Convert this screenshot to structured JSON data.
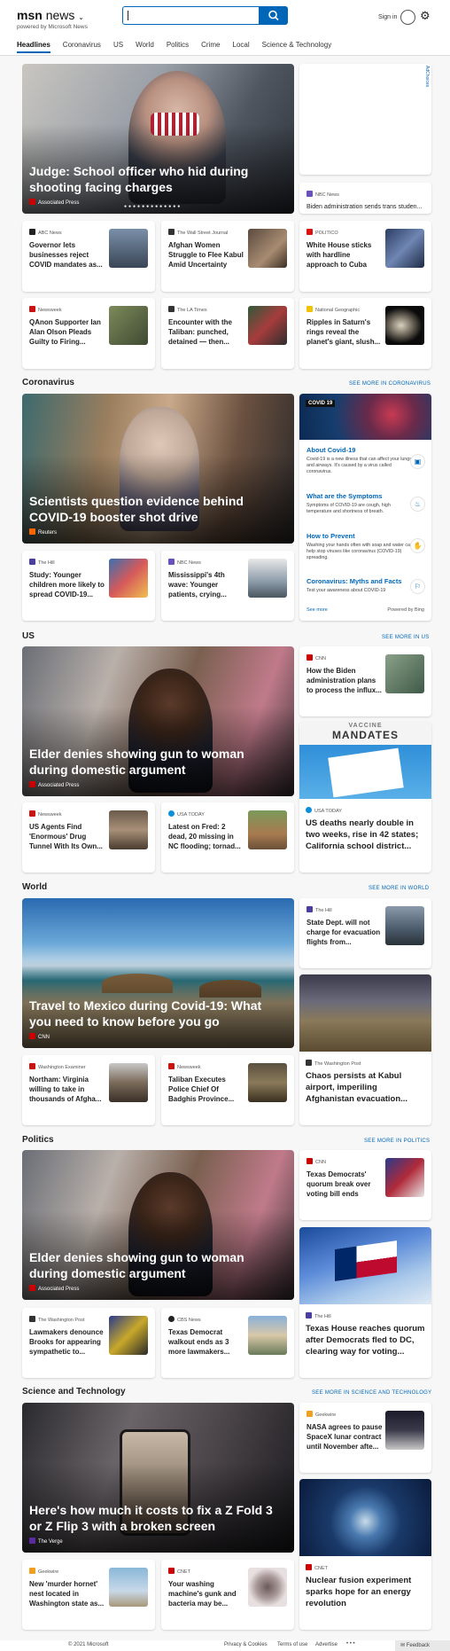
{
  "header": {
    "logo": "msn",
    "logo_sub": "news",
    "powered": "powered by Microsoft News",
    "signin": "Sign in",
    "search_value": ""
  },
  "nav": [
    "Headlines",
    "Coronavirus",
    "US",
    "World",
    "Politics",
    "Crime",
    "Local",
    "Science & Technology"
  ],
  "top": {
    "hero": {
      "title": "Judge: School officer who hid during shooting facing charges",
      "source": "Associated Press"
    },
    "side1": {
      "source": "NBC News",
      "title": "Biden administration sends trans studen..."
    },
    "row1": [
      {
        "source": "ABC News",
        "title": "Governor lets businesses reject COVID mandates as..."
      },
      {
        "source": "The Wall Street Journal",
        "title": "Afghan Women Struggle to Flee Kabul Amid Uncertainty"
      },
      {
        "source": "POLITICO",
        "title": "White House sticks with hardline approach to Cuba"
      }
    ],
    "row2": [
      {
        "source": "Newsweek",
        "title": "QAnon Supporter Ian Alan Olson Pleads Guilty to Firing..."
      },
      {
        "source": "The LA Times",
        "title": "Encounter with the Taliban: punched, detained — then..."
      },
      {
        "source": "National Geographic",
        "title": "Ripples in Saturn's rings reveal the planet's giant, slush..."
      }
    ]
  },
  "coronavirus": {
    "heading": "Coronavirus",
    "more": "SEE MORE IN CORONAVIRUS",
    "hero": {
      "title": "Scientists question evidence behind COVID-19 booster shot drive",
      "source": "Reuters"
    },
    "panel": {
      "banner": "COVID 19",
      "items": [
        {
          "title": "About Covid-19",
          "desc": "Covid-19 is a new illness that can affect your lungs and airways. It's caused by a virus called coronavirus."
        },
        {
          "title": "What are the Symptoms",
          "desc": "Symptoms of COVID-19 are cough, high temperature and shortness of breath."
        },
        {
          "title": "How to Prevent",
          "desc": "Washing your hands often with soap and water can help stop viruses like coronavirus (COVID-19) spreading."
        },
        {
          "title": "Coronavirus: Myths and Facts",
          "desc": "Test your awareness about COVID-19"
        }
      ],
      "see_more": "See more",
      "powered": "Powered by Bing"
    },
    "row": [
      {
        "source": "The Hill",
        "title": "Study: Younger children more likely to spread COVID-19..."
      },
      {
        "source": "NBC News",
        "title": "Mississippi's 4th wave: Younger patients, crying..."
      }
    ]
  },
  "us": {
    "heading": "US",
    "more": "SEE MORE IN US",
    "hero": {
      "title": "Elder denies showing gun to woman during domestic argument",
      "source": "Associated Press"
    },
    "side1": {
      "source": "CNN",
      "title": "How the Biden administration plans to process the influx..."
    },
    "side2": {
      "banner": "MANDATES",
      "banner_top": "VACCINE",
      "source": "USA TODAY",
      "title": "US deaths nearly double in two weeks, rise in 42 states; California school district..."
    },
    "row": [
      {
        "source": "Newsweek",
        "title": "US Agents Find 'Enormous' Drug Tunnel With Its Own..."
      },
      {
        "source": "USA TODAY",
        "title": "Latest on Fred: 2 dead, 20 missing in NC flooding; tornad..."
      }
    ]
  },
  "world": {
    "heading": "World",
    "more": "SEE MORE IN WORLD",
    "hero": {
      "title": "Travel to Mexico during Covid-19: What you need to know before you go",
      "source": "CNN"
    },
    "side1": {
      "source": "The Hill",
      "title": "State Dept. will not charge for evacuation flights from..."
    },
    "side2": {
      "source": "The Washington Post",
      "title": "Chaos persists at Kabul airport, imperiling Afghanistan evacuation..."
    },
    "row": [
      {
        "source": "Washington Examiner",
        "title": "Northam: Virginia willing to take in thousands of Afgha..."
      },
      {
        "source": "Newsweek",
        "title": "Taliban Executes Police Chief Of Badghis Province..."
      }
    ]
  },
  "politics": {
    "heading": "Politics",
    "more": "SEE MORE IN POLITICS",
    "hero": {
      "title": "Elder denies showing gun to woman during domestic argument",
      "source": "Associated Press"
    },
    "side1": {
      "source": "CNN",
      "title": "Texas Democrats' quorum break over voting bill ends"
    },
    "side2": {
      "source": "The Hill",
      "title": "Texas House reaches quorum after Democrats fled to DC, clearing way for voting..."
    },
    "row": [
      {
        "source": "The Washington Post",
        "title": "Lawmakers denounce Brooks for appearing sympathetic to..."
      },
      {
        "source": "CBS News",
        "title": "Texas Democrat walkout ends as 3 more lawmakers..."
      }
    ]
  },
  "scitech": {
    "heading": "Science and Technology",
    "more": "SEE MORE IN SCIENCE AND TECHNOLOGY",
    "hero": {
      "title": "Here's how much it costs to fix a Z Fold 3 or Z Flip 3 with a broken screen",
      "source": "The Verge"
    },
    "side1": {
      "source": "Geekwire",
      "title": "NASA agrees to pause SpaceX lunar contract until November afte..."
    },
    "side2": {
      "source": "CNET",
      "title": "Nuclear fusion experiment sparks hope for an energy revolution"
    },
    "row": [
      {
        "source": "Geekwire",
        "title": "New 'murder hornet' nest located in Washington state as..."
      },
      {
        "source": "CNET",
        "title": "Your washing machine's gunk and bacteria may be..."
      }
    ]
  },
  "footer": {
    "copyright": "© 2021 Microsoft",
    "privacy": "Privacy & Cookies",
    "terms": "Terms of use",
    "advertise": "Advertise",
    "more": "• • •",
    "feedback": "Feedback"
  }
}
